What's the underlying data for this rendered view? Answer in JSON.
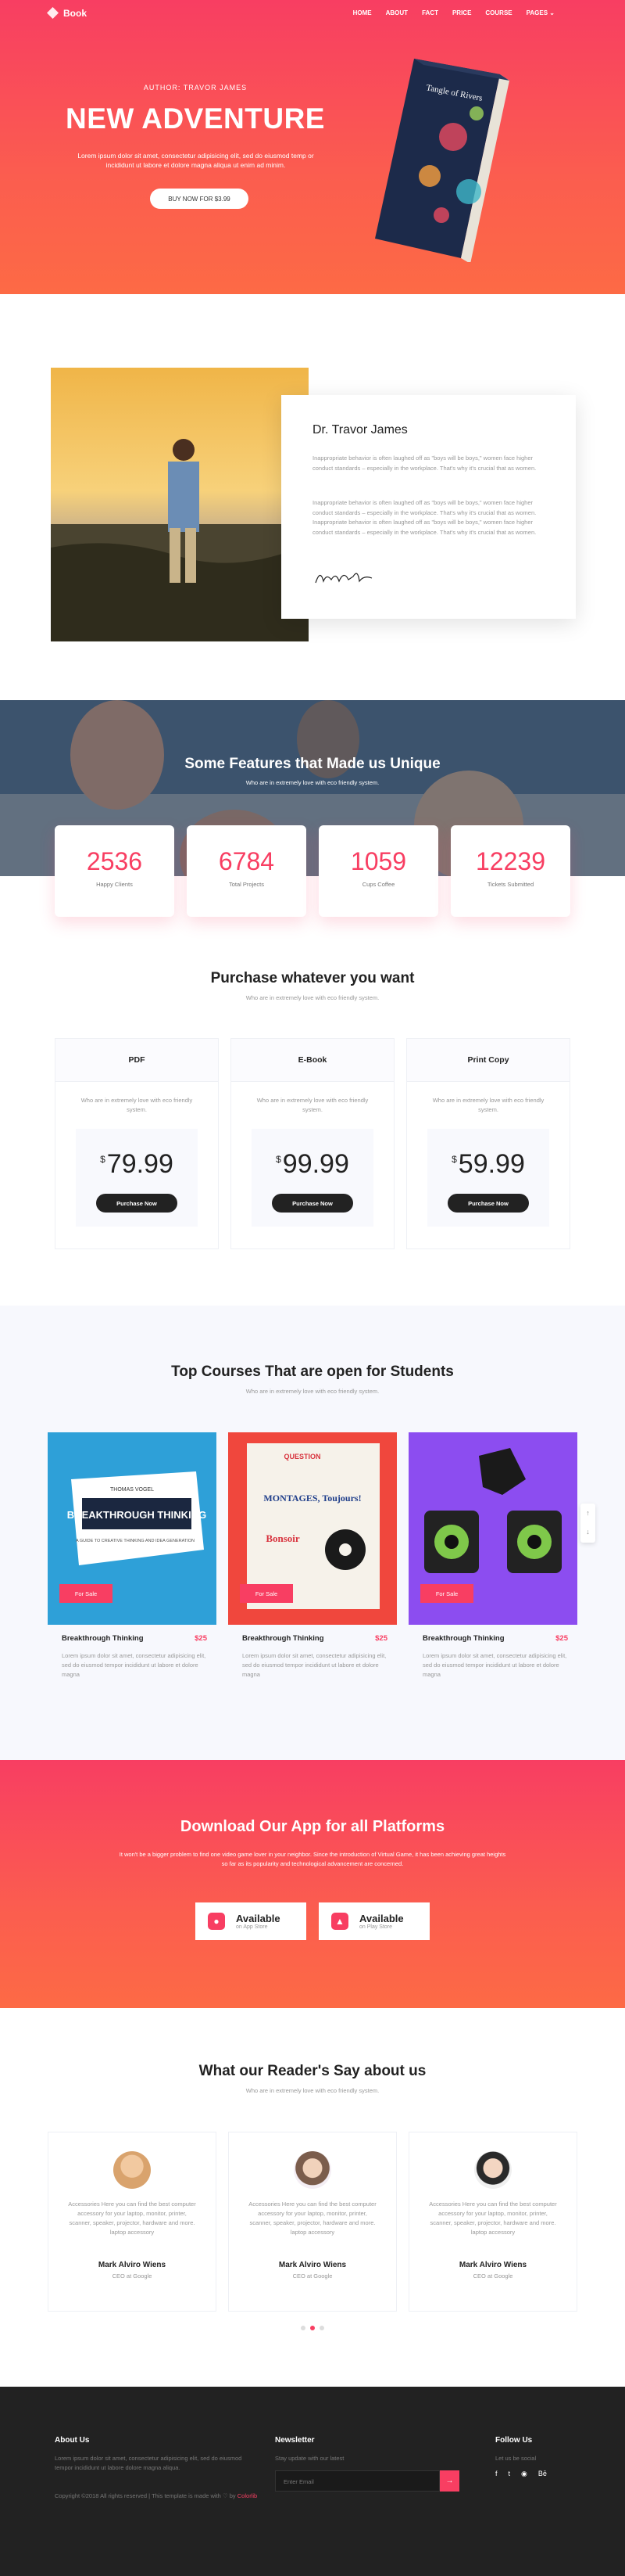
{
  "nav": {
    "brand": "Book",
    "menu": [
      "HOME",
      "ABOUT",
      "FACT",
      "PRICE",
      "COURSE",
      "PAGES"
    ]
  },
  "hero": {
    "author": "AUTHOR: TRAVOR JAMES",
    "title": "NEW ADVENTURE",
    "subtitle": "Lorem ipsum dolor sit amet, consectetur adipisicing elit, sed do eiusmod temp or incididunt ut labore et dolore magna aliqua ut enim ad minim.",
    "button": "BUY NOW FOR $3.99",
    "book_title": "Tangle of Rivers"
  },
  "about": {
    "name": "Dr. Travor James",
    "p1": "Inappropriate behavior is often laughed off as \"boys will be boys,\" women face higher conduct standards – especially in the workplace. That's why it's crucial that as women.",
    "p2": "Inappropriate behavior is often laughed off as \"boys will be boys,\" women face higher conduct standards – especially in the workplace. That's why it's crucial that as women. Inappropriate behavior is often laughed off as \"boys will be boys,\" women face higher conduct standards – especially in the workplace. That's why it's crucial that as women.",
    "signature": "LarryCraft"
  },
  "features": {
    "title": "Some Features that Made us Unique",
    "subtitle": "Who are in extremely love with eco friendly system.",
    "stats": [
      {
        "value": "2536",
        "label": "Happy Clients"
      },
      {
        "value": "6784",
        "label": "Total Projects"
      },
      {
        "value": "1059",
        "label": "Cups Coffee"
      },
      {
        "value": "12239",
        "label": "Tickets Submitted"
      }
    ]
  },
  "pricing": {
    "title": "Purchase whatever you want",
    "subtitle": "Who are in extremely love with eco friendly system.",
    "plans": [
      {
        "name": "PDF",
        "desc": "Who are in extremely love with eco friendly system.",
        "currency": "$",
        "price": "79.99",
        "button": "Purchase Now"
      },
      {
        "name": "E-Book",
        "desc": "Who are in extremely love with eco friendly system.",
        "currency": "$",
        "price": "99.99",
        "button": "Purchase Now"
      },
      {
        "name": "Print Copy",
        "desc": "Who are in extremely love with eco friendly system.",
        "currency": "$",
        "price": "59.99",
        "button": "Purchase Now"
      }
    ]
  },
  "courses": {
    "title": "Top Courses That are open for Students",
    "subtitle": "Who are in extremely love with eco friendly system.",
    "items": [
      {
        "title": "Breakthrough Thinking",
        "price": "$25",
        "tag": "For Sale",
        "desc": "Lorem ipsum dolor sit amet, consectetur adipisicing elit, sed do eiusmod tempor incididunt ut labore et dolore magna",
        "cover_top": "THOMAS VOGEL",
        "cover_main": "BREAKTHROUGH THINKING",
        "cover_sub": "A GUIDE TO CREATIVE THINKING AND IDEA GENERATION"
      },
      {
        "title": "Breakthrough Thinking",
        "price": "$25",
        "tag": "For Sale",
        "desc": "Lorem ipsum dolor sit amet, consectetur adipisicing elit, sed do eiusmod tempor incididunt ut labore et dolore magna",
        "cover_top": "QUESTION",
        "cover_main": "MONTAGES, Toujours!",
        "cover_sub": "Bonsoir"
      },
      {
        "title": "Breakthrough Thinking",
        "price": "$25",
        "tag": "For Sale",
        "desc": "Lorem ipsum dolor sit amet, consectetur adipisicing elit, sed do eiusmod tempor incididunt ut labore et dolore magna"
      }
    ],
    "slider": {
      "up": "↑",
      "down": "↓"
    }
  },
  "app": {
    "title": "Download Our App for all Platforms",
    "subtitle": "It won't be a bigger problem to find one video game lover in your neighbor. Since the introduction of Virtual Game, it has been achieving great heights so far as its popularity and technological advancement are concerned.",
    "stores": [
      {
        "title": "Available",
        "sub": "on App Store"
      },
      {
        "title": "Available",
        "sub": "on Play Store"
      }
    ]
  },
  "reviews": {
    "title": "What our Reader's Say about us",
    "subtitle": "Who are in extremely love with eco friendly system.",
    "items": [
      {
        "text": "Accessories Here you can find the best computer accessory for your laptop, monitor, printer, scanner, speaker, projector, hardware and more. laptop accessory",
        "name": "Mark Alviro Wiens",
        "role": "CEO at Google"
      },
      {
        "text": "Accessories Here you can find the best computer accessory for your laptop, monitor, printer, scanner, speaker, projector, hardware and more. laptop accessory",
        "name": "Mark Alviro Wiens",
        "role": "CEO at Google"
      },
      {
        "text": "Accessories Here you can find the best computer accessory for your laptop, monitor, printer, scanner, speaker, projector, hardware and more. laptop accessory",
        "name": "Mark Alviro Wiens",
        "role": "CEO at Google"
      }
    ]
  },
  "footer": {
    "about_title": "About Us",
    "about_text": "Lorem ipsum dolor sit amet, consectetur adipisicing elit, sed do eiusmod tempor incididunt ut labore dolore magna aliqua.",
    "copyright": "Copyright ©2018 All rights reserved | This template is made with ♡ by",
    "credit": "Colorlib",
    "newsletter_title": "Newsletter",
    "newsletter_text": "Stay update with our latest",
    "email_placeholder": "Enter Email",
    "follow_title": "Follow Us",
    "follow_text": "Let us be social",
    "social": [
      "f",
      "t",
      "◉",
      "Bē"
    ]
  },
  "colors": {
    "accent": "#f83e62",
    "accent2": "#fd6a45",
    "dark": "#222222"
  }
}
